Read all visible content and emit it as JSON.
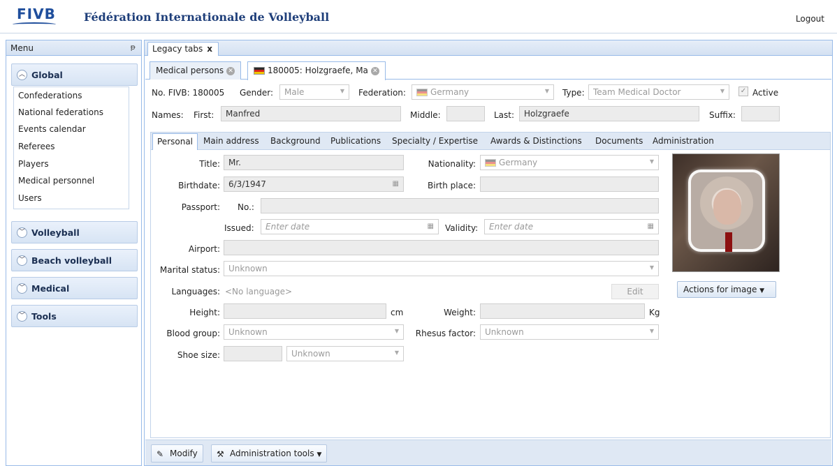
{
  "header": {
    "logo": "FIVB",
    "title": "Fédération Internationale de Volleyball",
    "logout": "Logout"
  },
  "menu": {
    "title": "Menu",
    "sections": [
      {
        "label": "Global",
        "expanded": true
      },
      {
        "label": "Volleyball"
      },
      {
        "label": "Beach volleyball"
      },
      {
        "label": "Medical"
      },
      {
        "label": "Tools"
      }
    ],
    "global_items": [
      "Confederations",
      "National federations",
      "Events calendar",
      "Referees",
      "Players",
      "Medical personnel",
      "Users"
    ]
  },
  "legacy_tab": {
    "label": "Legacy tabs",
    "close": "x"
  },
  "doc_tabs": [
    {
      "label": "Medical persons"
    },
    {
      "label": "180005: Holzgraefe, Ma"
    }
  ],
  "record": {
    "no_fivb_label": "No. FIVB: 180005",
    "gender_label": "Gender:",
    "gender": "Male",
    "federation_label": "Federation:",
    "federation": "Germany",
    "type_label": "Type:",
    "type": "Team Medical Doctor",
    "active_label": "Active",
    "names_label": "Names:",
    "first_label": "First:",
    "first": "Manfred",
    "middle_label": "Middle:",
    "middle": "",
    "last_label": "Last:",
    "last": "Holzgraefe",
    "suffix_label": "Suffix:",
    "suffix": ""
  },
  "sub_tabs": [
    "Personal",
    "Main address",
    "Background",
    "Publications",
    "Specialty / Expertise",
    "Awards & Distinctions",
    "Documents",
    "Administration"
  ],
  "personal": {
    "title_label": "Title:",
    "title": "Mr.",
    "nationality_label": "Nationality:",
    "nationality": "Germany",
    "birthdate_label": "Birthdate:",
    "birthdate": "6/3/1947",
    "birthplace_label": "Birth place:",
    "birthplace": "",
    "passport_label": "Passport:",
    "no_label": "No.:",
    "passport_no": "",
    "issued_label": "Issued:",
    "issued_placeholder": "Enter date",
    "validity_label": "Validity:",
    "validity_placeholder": "Enter date",
    "airport_label": "Airport:",
    "airport": "",
    "marital_label": "Marital status:",
    "marital": "Unknown",
    "languages_label": "Languages:",
    "languages": "<No language>",
    "edit_label": "Edit",
    "height_label": "Height:",
    "height": "",
    "height_unit": "cm",
    "weight_label": "Weight:",
    "weight": "",
    "weight_unit": "Kg",
    "blood_label": "Blood group:",
    "blood": "Unknown",
    "rhesus_label": "Rhesus factor:",
    "rhesus": "Unknown",
    "shoe_label": "Shoe size:",
    "shoe": "",
    "shoe_unit": "Unknown"
  },
  "image": {
    "actions_label": "Actions for image"
  },
  "bottom": {
    "modify_label": "Modify",
    "admin_tools_label": "Administration tools"
  },
  "colors": {
    "accent": "#1f4e9c",
    "border": "#99bbe8",
    "panel": "#dfe8f4"
  }
}
